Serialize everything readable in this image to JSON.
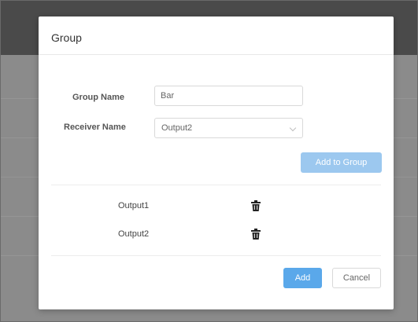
{
  "dialog": {
    "title": "Group",
    "group_name_label": "Group Name",
    "group_name_value": "Bar",
    "receiver_name_label": "Receiver Name",
    "receiver_name_value": "Output2",
    "add_to_group_label": "Add to Group",
    "members": [
      {
        "name": "Output1",
        "icon": "trash-icon"
      },
      {
        "name": "Output2",
        "icon": "trash-icon"
      }
    ],
    "add_label": "Add",
    "cancel_label": "Cancel"
  },
  "colors": {
    "primary": "#5aa8ea",
    "primary_disabled": "#9cc8ef",
    "header_bg": "#4a4a4a",
    "overlay_bg": "#8b8b8b"
  }
}
